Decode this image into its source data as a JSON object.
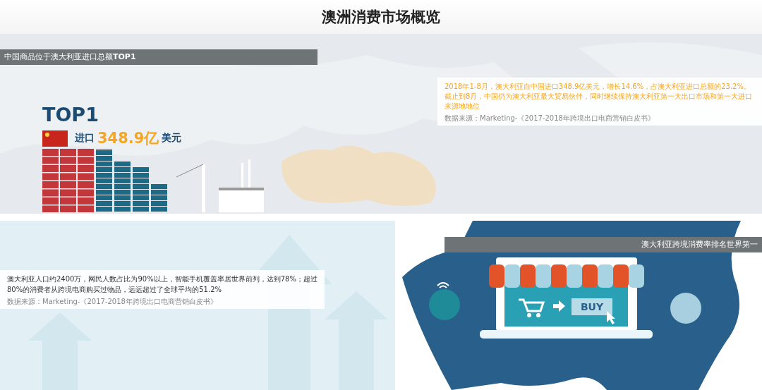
{
  "page_title": "澳洲消费市场概览",
  "import_section": {
    "header": "中国商品位于澳大利亚进口总额**TOP1**",
    "rank": "TOP1",
    "import_label": "进口",
    "import_amount": "348.9亿",
    "currency": "美元",
    "note": {
      "text": "2018年1-8月，澳大利亚自中国进口348.9亿美元，增长14.6%，占澳大利亚进口总额的23.2%。截止到8月，中国仍为澳大利亚最大贸易伙伴，同时继续保持澳大利亚第一大出口市场和第一大进口来源地地位",
      "source": "数据来源：Marketing-《2017-2018年跨境出口电商营销白皮书》"
    }
  },
  "ecommerce_section": {
    "header": "澳大利亚跨境消费率排名世界第一",
    "buy_label": "BUY",
    "note": {
      "text": "澳大利亚人口约2400万，网民人数占比为90%以上，智能手机覆盖率居世界前列，达到78%；超过80%的消费者从跨境电商购买过物品，远远超过了全球平均的51.2%",
      "source": "数据来源：Marketing-《2017-2018年跨境出口电商营销白皮书》"
    }
  }
}
